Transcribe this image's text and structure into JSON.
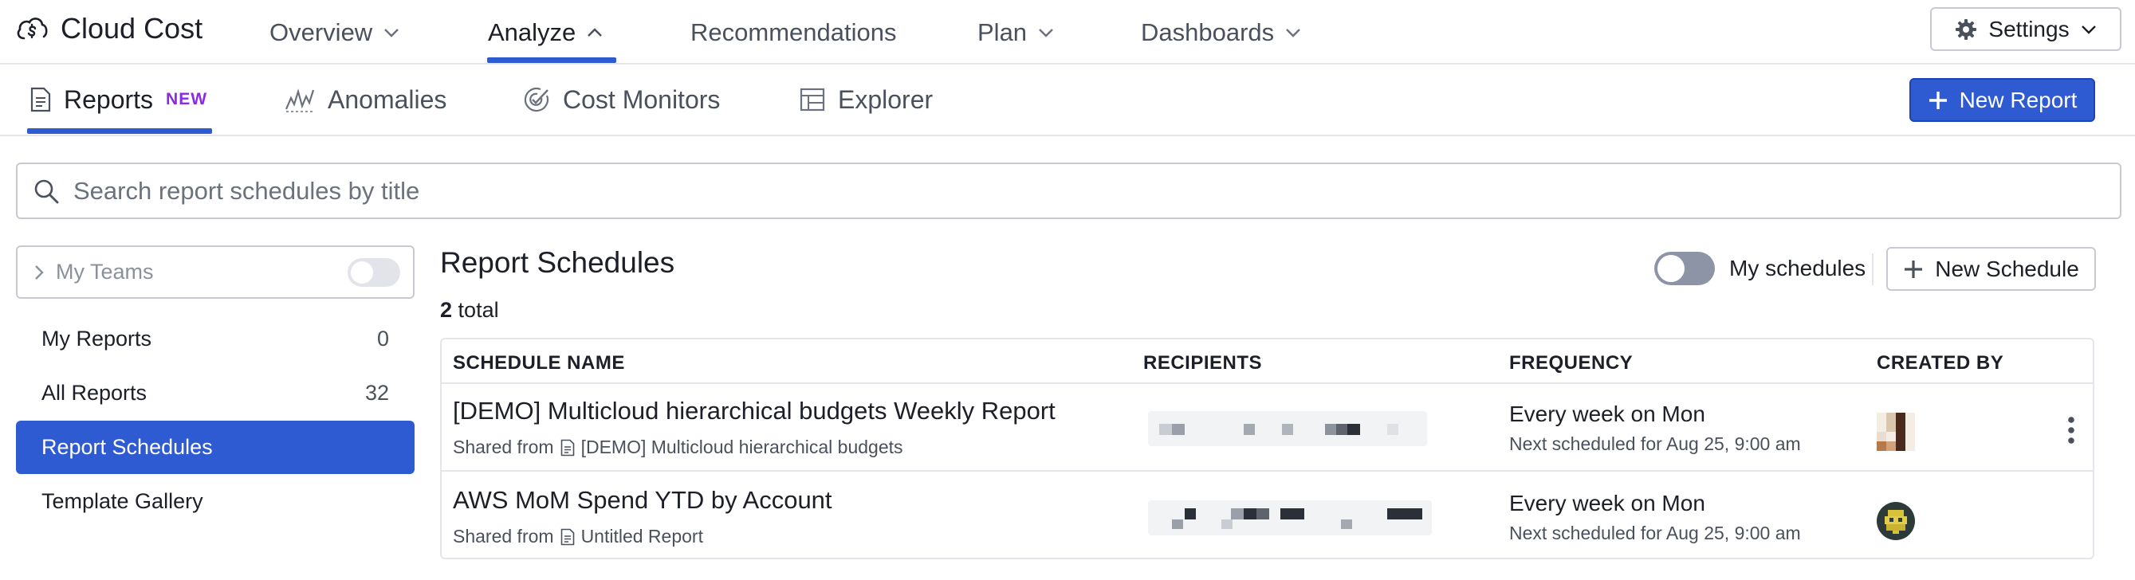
{
  "app": {
    "title": "Cloud Cost"
  },
  "nav": [
    {
      "label": "Overview"
    },
    {
      "label": "Analyze"
    },
    {
      "label": "Recommendations"
    },
    {
      "label": "Plan"
    },
    {
      "label": "Dashboards"
    }
  ],
  "settings": {
    "label": "Settings"
  },
  "tabs": [
    {
      "label": "Reports",
      "badge": "NEW"
    },
    {
      "label": "Anomalies"
    },
    {
      "label": "Cost Monitors"
    },
    {
      "label": "Explorer"
    }
  ],
  "new_report": {
    "label": "New Report"
  },
  "search": {
    "placeholder": "Search report schedules by title",
    "value": ""
  },
  "sidebar": {
    "teams_label": "My Teams",
    "items": [
      {
        "label": "My Reports",
        "count": "0"
      },
      {
        "label": "All Reports",
        "count": "32"
      },
      {
        "label": "Report Schedules",
        "count": ""
      },
      {
        "label": "Template Gallery",
        "count": ""
      }
    ]
  },
  "main": {
    "title": "Report Schedules",
    "total_count": "2",
    "total_label": "total",
    "my_schedules_label": "My schedules",
    "new_schedule_label": "New Schedule"
  },
  "table": {
    "columns": [
      "SCHEDULE NAME",
      "RECIPIENTS",
      "FREQUENCY",
      "CREATED BY"
    ],
    "rows": [
      {
        "name": "[DEMO] Multicloud hierarchical budgets Weekly Report",
        "shared_prefix": "Shared from",
        "shared_from": "[DEMO] Multicloud hierarchical budgets",
        "frequency": "Every week on Mon",
        "next": "Next scheduled for Aug 25, 9:00 am"
      },
      {
        "name": "AWS MoM Spend YTD by Account",
        "shared_prefix": "Shared from",
        "shared_from": "Untitled Report",
        "frequency": "Every week on Mon",
        "next": "Next scheduled for Aug 25, 9:00 am"
      }
    ]
  },
  "colors": {
    "accent": "#2e5ad2",
    "badge_new": "#8a2be2",
    "border": "#c7cad2"
  },
  "icons": {
    "brand": "cloud-dollar-icon",
    "settings": "gear-icon",
    "reports": "document-icon",
    "anomalies": "anomaly-chart-icon",
    "monitors": "monitor-target-icon",
    "explorer": "grid-table-icon",
    "search": "search-icon",
    "add": "plus-icon"
  }
}
